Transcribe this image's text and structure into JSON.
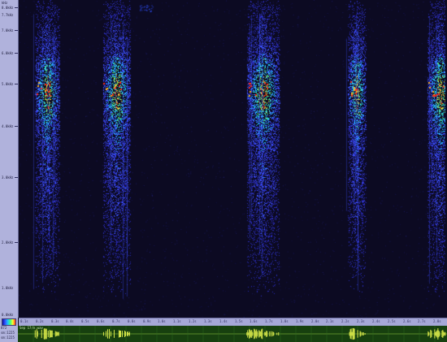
{
  "freq_axis": {
    "top_label": "kHz",
    "labels": [
      "8.0kHz",
      "7.7kHz",
      "7.0kHz",
      "6.0kHz",
      "5.0kHz",
      "4.0kHz",
      "3.0kHz",
      "2.0kHz",
      "1.0kHz",
      "0.0kHz"
    ],
    "max_khz": 8.1
  },
  "time_ruler": {
    "labels": [
      "0.1s",
      "0.2s",
      "0.3s",
      "0.4s",
      "0.5s",
      "0.6s",
      "0.7s",
      "0.8s",
      "0.9s",
      "1.0s",
      "1.1s",
      "1.2s",
      "1.3s",
      "1.4s",
      "1.5s",
      "1.6s",
      "1.7s",
      "1.8s",
      "1.9s",
      "2.0s",
      "2.1s",
      "2.2s",
      "2.3s",
      "2.4s",
      "2.5s",
      "2.6s",
      "2.7s",
      "2.8s"
    ]
  },
  "bottom_info": {
    "colormap_icon": "colormap-icon",
    "line1": "872",
    "line2": "sm:1225",
    "line3": "sm:1225"
  },
  "waveform": {
    "file_label": "Sep 17/n.wav",
    "color": "#d9e84a"
  },
  "spectrogram": {
    "background": "#0c0a22",
    "calls": [
      0.05,
      0.21,
      0.55,
      0.78,
      0.97
    ]
  }
}
